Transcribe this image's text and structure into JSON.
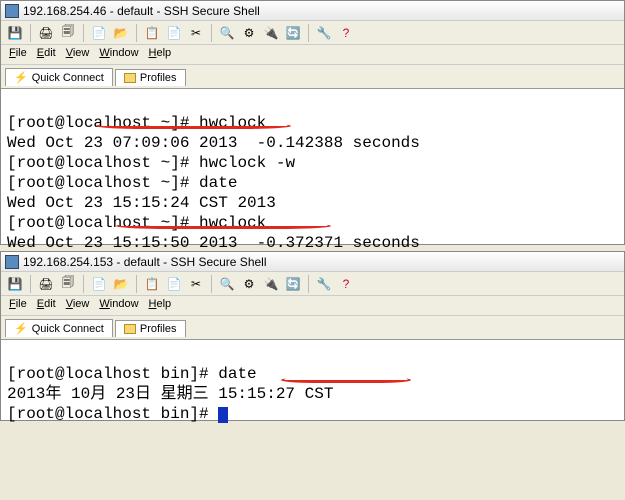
{
  "window1": {
    "title": "192.168.254.46 - default - SSH Secure Shell",
    "menus": {
      "file": "File",
      "edit": "Edit",
      "view": "View",
      "window": "Window",
      "help": "Help"
    },
    "tabs": {
      "quick_connect": "Quick Connect",
      "profiles": "Profiles"
    },
    "toolbar_icons": {
      "save": "save-icon",
      "print": "print-icon",
      "print_preview": "print-preview-icon",
      "new": "new-icon",
      "open": "open-icon",
      "cut": "cut-icon",
      "copy": "copy-icon",
      "paste": "paste-icon",
      "find": "find-icon",
      "settings": "settings-icon",
      "disconnect": "disconnect-icon",
      "refresh": "refresh-icon",
      "tools": "tools-icon",
      "help": "help-icon"
    },
    "lines": {
      "l0": "[root@localhost ~]# hwclock",
      "l1": "Wed Oct 23 07:09:06 2013  -0.142388 seconds",
      "l2": "[root@localhost ~]# hwclock -w",
      "l3": "[root@localhost ~]# date",
      "l4": "Wed Oct 23 15:15:24 CST 2013",
      "l5": "[root@localhost ~]# hwclock",
      "l6": "Wed Oct 23 15:15:50 2013  -0.372371 seconds"
    }
  },
  "window2": {
    "title": "192.168.254.153 - default - SSH Secure Shell",
    "menus": {
      "file": "File",
      "edit": "Edit",
      "view": "View",
      "window": "Window",
      "help": "Help"
    },
    "tabs": {
      "quick_connect": "Quick Connect",
      "profiles": "Profiles"
    },
    "lines": {
      "l0": "[root@localhost bin]# date",
      "l1": "2013年 10月 23日 星期三 15:15:27 CST",
      "l2a": "[root@localhost bin]# ",
      "l2b": ""
    }
  }
}
